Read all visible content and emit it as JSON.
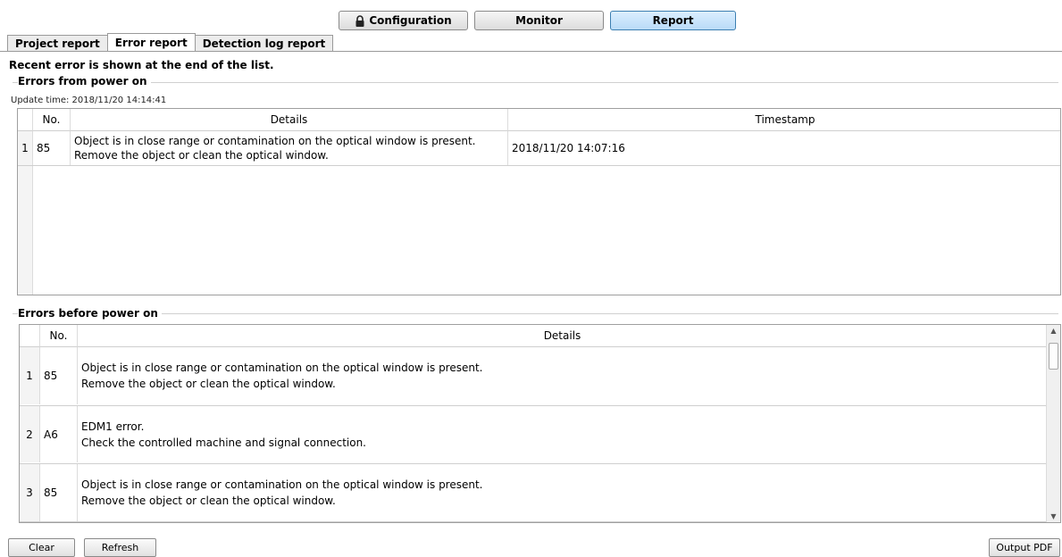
{
  "mode_buttons": {
    "configuration": "Configuration",
    "monitor": "Monitor",
    "report": "Report"
  },
  "tabs": [
    "Project report",
    "Error report",
    "Detection log report"
  ],
  "active_tab": "Error report",
  "recent_note": "Recent error is shown at the end of the list.",
  "power_on": {
    "title": "Errors from power on",
    "update_time": "Update time: 2018/11/20 14:14:41",
    "headers": {
      "no": "No.",
      "details": "Details",
      "timestamp": "Timestamp"
    },
    "rows": [
      {
        "index": "1",
        "no": "85",
        "details_line1": "Object is in close range or contamination on the optical window is present.",
        "details_line2": "Remove the object or clean the optical window.",
        "timestamp": "2018/11/20 14:07:16"
      }
    ]
  },
  "before_power_on": {
    "title": "Errors before power on",
    "headers": {
      "no": "No.",
      "details": "Details"
    },
    "rows": [
      {
        "index": "1",
        "no": "85",
        "line1": "Object is in close range or contamination on the optical window is present.",
        "line2": "Remove the object or clean the optical window."
      },
      {
        "index": "2",
        "no": "A6",
        "line1": "EDM1 error.",
        "line2": "Check the controlled machine and signal connection."
      },
      {
        "index": "3",
        "no": "85",
        "line1": "Object is in close range or contamination on the optical window is present.",
        "line2": "Remove the object or clean the optical window."
      }
    ]
  },
  "buttons": {
    "clear": "Clear",
    "refresh": "Refresh",
    "output_pdf": "Output PDF"
  },
  "colors": {
    "active_mode": "#b9dbf7",
    "border": "#9f9f9f"
  },
  "icons": {
    "configuration": "lock-icon"
  }
}
